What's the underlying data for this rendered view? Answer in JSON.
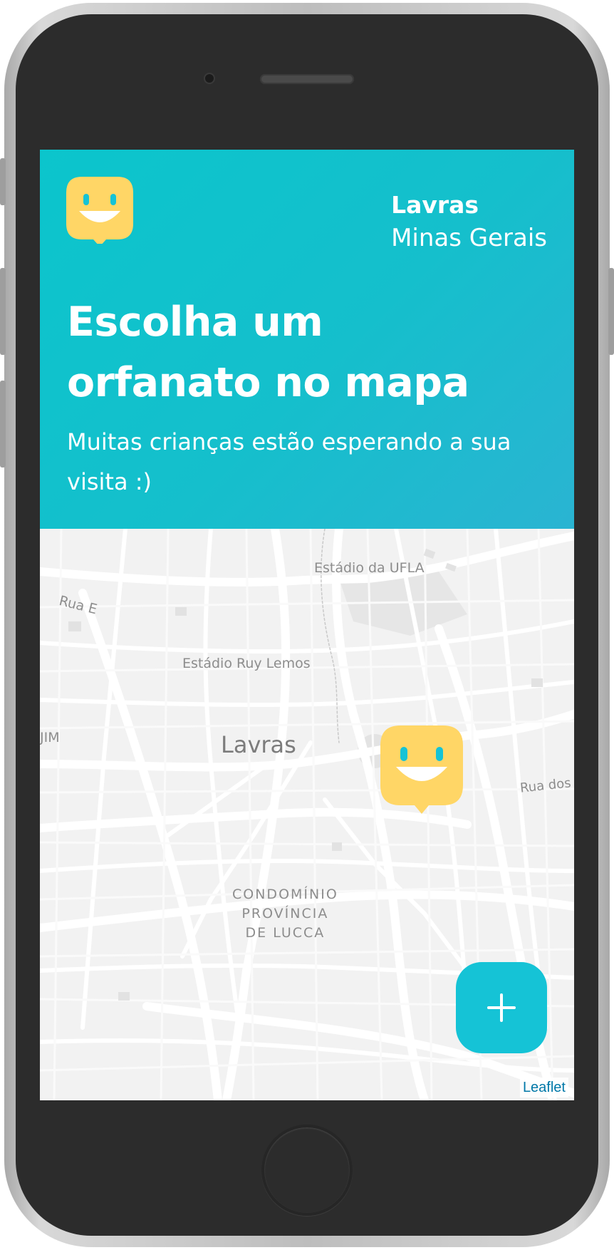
{
  "header": {
    "city": "Lavras",
    "state": "Minas Gerais",
    "title_line1": "Escolha um",
    "title_line2": "orfanato no mapa",
    "subtitle": "Muitas crianças estão esperando a sua visita :)"
  },
  "map": {
    "labels": {
      "estadio_ufla": "Estádio da UFLA",
      "rua_e": "Rua E",
      "estadio_ruy_lemos": "Estádio Ruy Lemos",
      "lavras": "Lavras",
      "jim": "JIM",
      "rua_dos": "Rua dos",
      "condominio_1": "CONDOMÍNIO",
      "condominio_2": "PROVÍNCIA",
      "condominio_3": "DE LUCCA"
    },
    "attribution": "Leaflet",
    "markers": [
      {
        "icon": "orphanage-smiley-icon"
      }
    ]
  },
  "fab": {
    "icon": "plus-icon"
  },
  "colors": {
    "header_start": "#0bc5cc",
    "header_end": "#2ab4d2",
    "logo_yellow": "#ffd666",
    "fab": "#15c3d6",
    "map_background": "#f2f2f2",
    "attribution_link": "#0078a8"
  }
}
